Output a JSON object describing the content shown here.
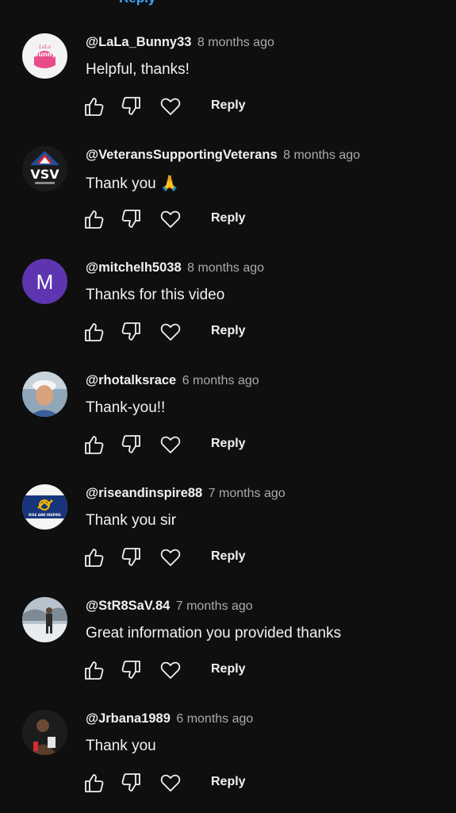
{
  "top_partial_text": "Reply",
  "comments": [
    {
      "handle": "@LaLa_Bunny33",
      "time": "8 months ago",
      "text": "Helpful, thanks!",
      "avatar": "bunny-logo-avatar",
      "avatar_text": "Bunny",
      "reply_label": "Reply"
    },
    {
      "handle": "@VeteransSupportingVeterans",
      "time": "8 months ago",
      "text": "Thank you 🙏",
      "avatar": "vsv-logo-avatar",
      "avatar_text": "VSV",
      "reply_label": "Reply"
    },
    {
      "handle": "@mitchelh5038",
      "time": "8 months ago",
      "text": "Thanks for this video",
      "avatar": "letter-avatar",
      "avatar_text": "M",
      "avatar_color": "#5e35b1",
      "reply_label": "Reply"
    },
    {
      "handle": "@rhotalksrace",
      "time": "6 months ago",
      "text": "Thank-you!!",
      "avatar": "photo-avatar",
      "reply_label": "Reply"
    },
    {
      "handle": "@riseandinspire88",
      "time": "7 months ago",
      "text": "Thank you sir",
      "avatar": "rise-inspire-logo-avatar",
      "avatar_text": "RISE AND INSPIRE",
      "reply_label": "Reply"
    },
    {
      "handle": "@StR8SaV.84",
      "time": "7 months ago",
      "text": "Great information you provided thanks",
      "avatar": "photo-avatar",
      "reply_label": "Reply"
    },
    {
      "handle": "@Jrbana1989",
      "time": "6 months ago",
      "text": "Thank you",
      "avatar": "photo-avatar",
      "reply_label": "Reply"
    }
  ],
  "icons": {
    "like": "thumbs-up-icon",
    "dislike": "thumbs-down-icon",
    "heart": "heart-icon"
  }
}
